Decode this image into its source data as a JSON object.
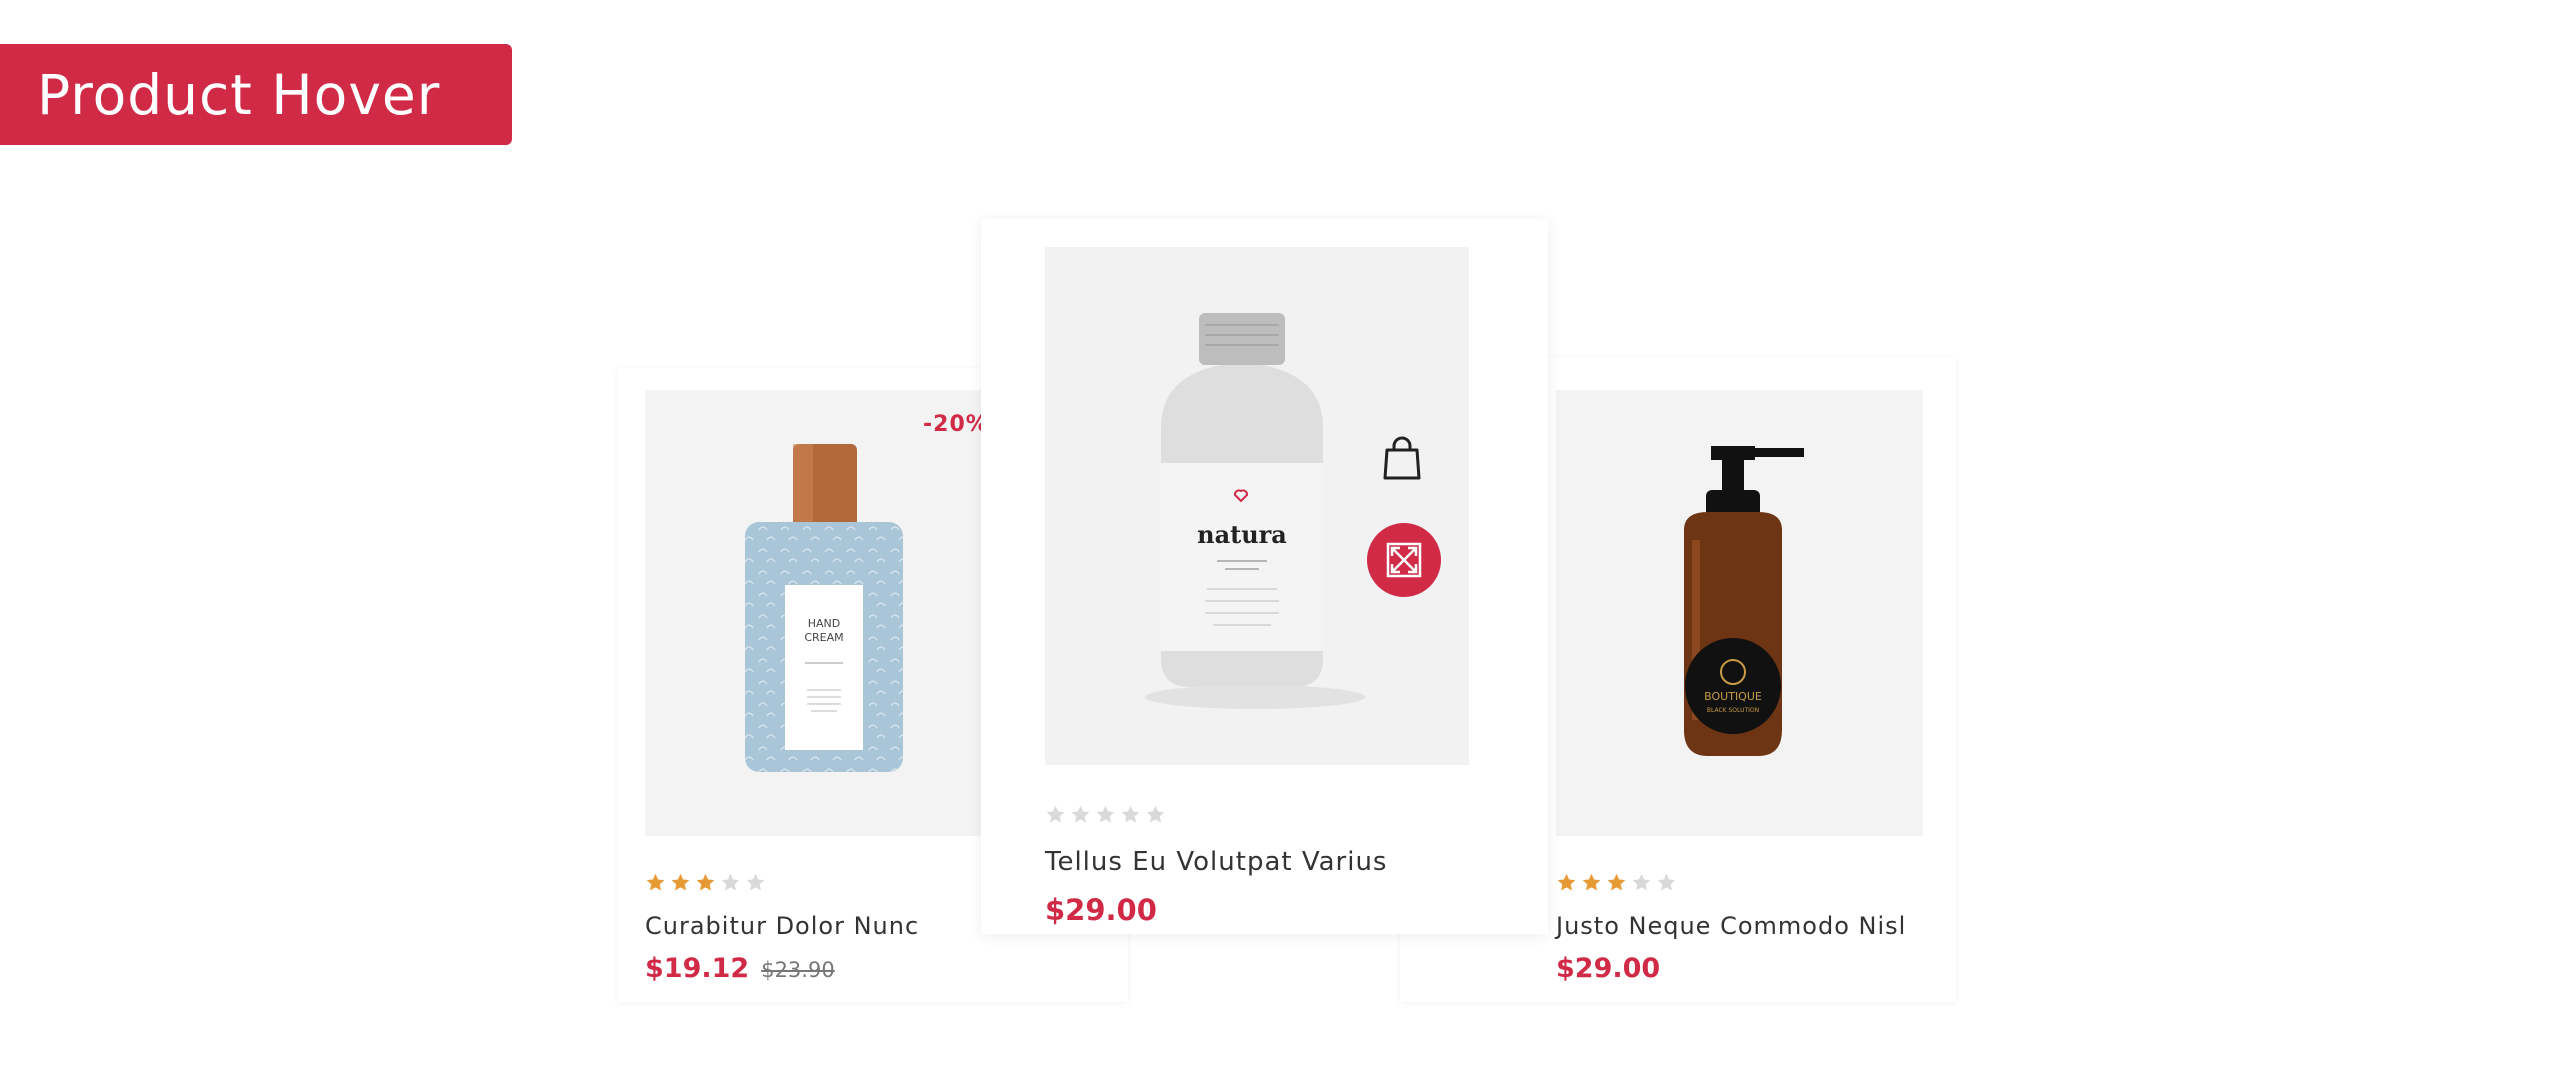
{
  "banner": {
    "title": "Product Hover"
  },
  "colors": {
    "accent": "#d12a47",
    "star_filled": "#e69a34",
    "star_empty": "#d9d9d9",
    "image_bg": "#f3f3f3"
  },
  "products": [
    {
      "title": "Curabitur Dolor Nunc",
      "price": "$19.12",
      "old_price": "$23.90",
      "discount": "-20%",
      "rating": 3,
      "rating_max": 5,
      "image": {
        "type": "bottle",
        "label_line1": "HAND",
        "label_line2": "CREAM"
      }
    },
    {
      "title": "Tellus Eu Volutpat Varius",
      "price": "$29.00",
      "rating": 0,
      "rating_max": 5,
      "hovered": true,
      "image": {
        "type": "bottle",
        "label_line1": "natura"
      }
    },
    {
      "title": "Justo Neque Commodo Nisl",
      "price": "$29.00",
      "rating": 3,
      "rating_max": 5,
      "image": {
        "type": "pump-bottle",
        "label_line1": "BOUTIQUE",
        "label_line2": "BLACK SOLUTION"
      }
    }
  ],
  "actions": {
    "cart_icon": "shopping-bag-icon",
    "quickview_icon": "expand-arrows-icon"
  }
}
